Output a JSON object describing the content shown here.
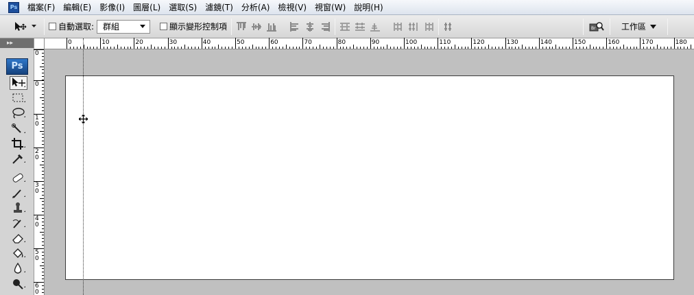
{
  "menubar": {
    "app_icon": "Ps",
    "items": [
      {
        "label": "檔案(F)"
      },
      {
        "label": "編輯(E)"
      },
      {
        "label": "影像(I)"
      },
      {
        "label": "圖層(L)"
      },
      {
        "label": "選取(S)"
      },
      {
        "label": "濾鏡(T)"
      },
      {
        "label": "分析(A)"
      },
      {
        "label": "檢視(V)"
      },
      {
        "label": "視窗(W)"
      },
      {
        "label": "說明(H)"
      }
    ]
  },
  "options": {
    "auto_select_label": "自動選取:",
    "auto_select_checked": false,
    "auto_select_value": "群組",
    "show_transform_label": "顯示變形控制項",
    "show_transform_checked": false,
    "workspace_label": "工作區"
  },
  "tools": {
    "collapse_label": "▸▸",
    "logo": "Ps",
    "items": [
      {
        "icon": "move-tool-icon",
        "active": true
      },
      {
        "icon": "rectangular-marquee-icon"
      },
      {
        "icon": "lasso-icon"
      },
      {
        "icon": "quick-selection-icon"
      },
      {
        "icon": "crop-icon"
      },
      {
        "icon": "eyedropper-icon"
      },
      {
        "icon": "spot-healing-icon"
      },
      {
        "icon": "brush-icon"
      },
      {
        "icon": "clone-stamp-icon"
      },
      {
        "icon": "history-brush-icon"
      },
      {
        "icon": "eraser-icon"
      },
      {
        "icon": "paint-bucket-icon"
      },
      {
        "icon": "blur-icon"
      },
      {
        "icon": "dodge-icon"
      }
    ]
  },
  "rulers": {
    "horizontal_labels": [
      "0",
      "10",
      "20",
      "30",
      "40",
      "50",
      "60",
      "70",
      "80",
      "90",
      "100",
      "110",
      "120",
      "130",
      "140",
      "150",
      "160",
      "170",
      "180"
    ],
    "vertical_labels": [
      "0",
      "0",
      "10",
      "20",
      "30",
      "40",
      "50",
      "60"
    ]
  },
  "colors": {
    "canvas_bg": "#c0c0c0",
    "document_bg": "#ffffff",
    "ps_blue": "#1e4f9c"
  }
}
